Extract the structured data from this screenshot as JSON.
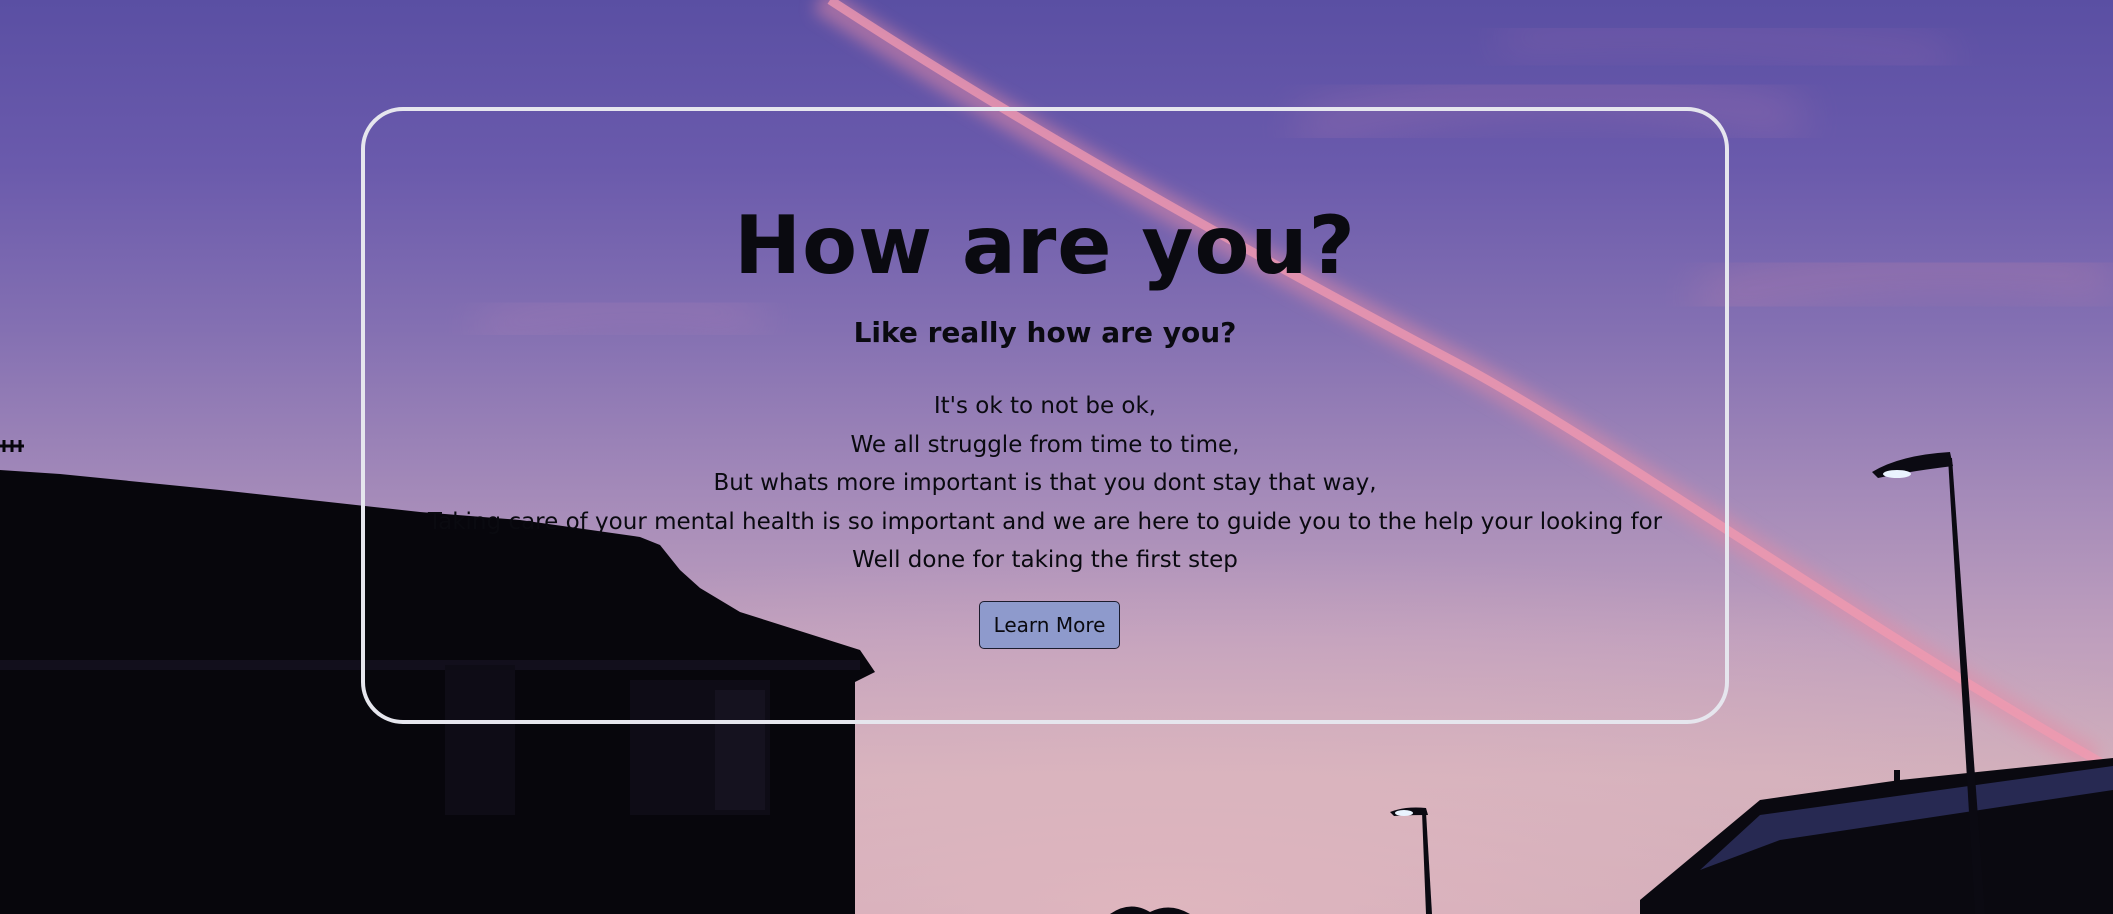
{
  "hero": {
    "title": "How are you?",
    "subtitle": "Like really how are you?",
    "lines": [
      "It's ok to not be ok,",
      "We all struggle from time to time,",
      "But whats more important is that you dont stay that way,",
      "Taking care of your mental health is so important and we are here to guide you to the help your looking for",
      "Well done for taking the first step"
    ],
    "button_label": "Learn More"
  },
  "colors": {
    "sky_top": "#5a4fa3",
    "sky_bottom": "#cfaebb",
    "contrail": "#e48aa6",
    "card_border": "#e6e6ee",
    "button_bg": "#8e9acc",
    "text": "#0a0a10"
  },
  "icons": {
    "background": "sunset-sky-photo",
    "houses": "house-silhouette",
    "lamps": "street-lamp"
  }
}
